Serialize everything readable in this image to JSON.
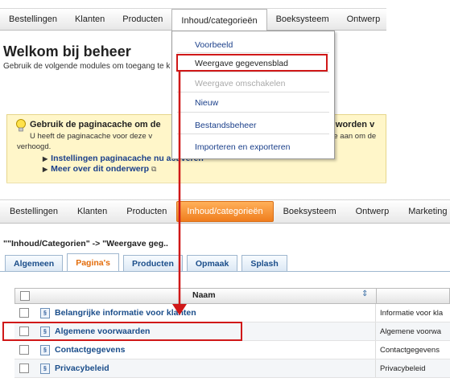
{
  "top": {
    "menu": [
      "Bestellingen",
      "Klanten",
      "Producten",
      "Inhoud/categorieën",
      "Boeksysteem",
      "Ontwerp"
    ],
    "welcome_title": "Welkom bij beheer",
    "welcome_sub": "Gebruik de volgende modules om toegang te k",
    "notice": {
      "title": "Gebruik de paginacache om de",
      "title_right": "a's worden v",
      "text": "U heeft de paginacache voor deze v",
      "text_right": "ste aan om de",
      "text2": "verhoogd.",
      "link1": "Instellingen paginacache nu activeren",
      "link2": "Meer over dit onderwerp"
    },
    "dropdown": [
      "Voorbeeld",
      "Weergave gegevensblad",
      "Weergave omschakelen",
      "Nieuw",
      "Bestandsbeheer",
      "Importeren en exporteren"
    ]
  },
  "bottom": {
    "menu": [
      "Bestellingen",
      "Klanten",
      "Producten",
      "Inhoud/categorieën",
      "Boeksysteem",
      "Ontwerp",
      "Marketing"
    ],
    "breadcrumb": "\"\"Inhoud/Categorien\" -> \"Weergave geg..",
    "tabs": [
      "Algemeen",
      "Pagina's",
      "Producten",
      "Opmaak",
      "Splash"
    ],
    "column_name": "Naam",
    "rows": [
      {
        "name": "Belangrijke informatie voor klanten",
        "desc": "Informatie voor kla"
      },
      {
        "name": "Algemene voorwaarden",
        "desc": "Algemene voorwa"
      },
      {
        "name": "Contactgegevens",
        "desc": "Contactgegevens"
      },
      {
        "name": "Privacybeleid",
        "desc": "Privacybeleid"
      }
    ]
  },
  "colors": {
    "highlight": "#d01818",
    "active_tab": "#e36c0a",
    "link": "#1a4d8a",
    "active_menu": "#f07e1e"
  }
}
